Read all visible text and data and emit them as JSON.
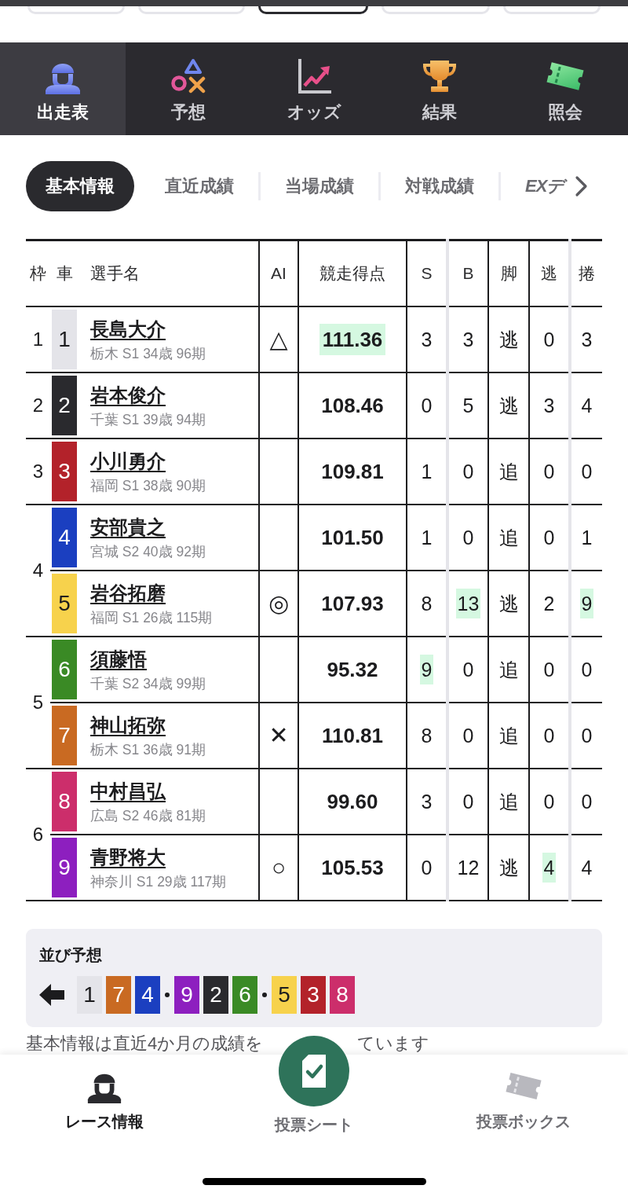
{
  "race_tabs": [
    {
      "selected": false
    },
    {
      "selected": false
    },
    {
      "selected": true
    },
    {
      "selected": false
    },
    {
      "selected": false
    }
  ],
  "main_nav": [
    {
      "label": "出走表",
      "selected": true
    },
    {
      "label": "予想",
      "selected": false
    },
    {
      "label": "オッズ",
      "selected": false
    },
    {
      "label": "結果",
      "selected": false
    },
    {
      "label": "照会",
      "selected": false
    }
  ],
  "sub_tabs": [
    {
      "label": "基本情報",
      "kind": "text",
      "selected": true
    },
    {
      "label": "直近成績",
      "kind": "text",
      "selected": false
    },
    {
      "label": "当場成績",
      "kind": "text",
      "selected": false
    },
    {
      "label": "対戦成績",
      "kind": "text",
      "selected": false
    },
    {
      "label": "EXデ",
      "kind": "logo",
      "selected": false
    }
  ],
  "table": {
    "columns": [
      "枠",
      "車",
      "選手名",
      "AI",
      "競走得点",
      "S",
      "B",
      "脚",
      "逃",
      "捲"
    ],
    "frames": [
      {
        "frame": "1",
        "riders": [
          {
            "car": "1",
            "color": "#e4e4e9",
            "name": "長島大介",
            "profile": "栃木 S1 34歳 96期",
            "ai_mark": "△",
            "score": {
              "value": "111.36",
              "highlighted": true
            },
            "stats": [
              {
                "value": "3",
                "highlighted": false
              },
              {
                "value": "3",
                "highlighted": false
              },
              {
                "value": "逃",
                "highlighted": false
              },
              {
                "value": "0",
                "highlighted": false
              },
              {
                "value": "3",
                "highlighted": false
              }
            ]
          }
        ]
      },
      {
        "frame": "2",
        "riders": [
          {
            "car": "2",
            "color": "#2a2a2e",
            "name": "岩本俊介",
            "profile": "千葉 S1 39歳 94期",
            "score": {
              "value": "108.46",
              "highlighted": false
            },
            "stats": [
              {
                "value": "0",
                "highlighted": false
              },
              {
                "value": "5",
                "highlighted": false
              },
              {
                "value": "逃",
                "highlighted": false
              },
              {
                "value": "3",
                "highlighted": false
              },
              {
                "value": "4",
                "highlighted": false
              }
            ]
          }
        ]
      },
      {
        "frame": "3",
        "riders": [
          {
            "car": "3",
            "color": "#b3222a",
            "name": "小川勇介",
            "profile": "福岡 S1 38歳 90期",
            "score": {
              "value": "109.81",
              "highlighted": false
            },
            "stats": [
              {
                "value": "1",
                "highlighted": false
              },
              {
                "value": "0",
                "highlighted": false
              },
              {
                "value": "追",
                "highlighted": false
              },
              {
                "value": "0",
                "highlighted": false
              },
              {
                "value": "0",
                "highlighted": false
              }
            ]
          }
        ]
      },
      {
        "frame": "4",
        "riders": [
          {
            "car": "4",
            "color": "#1b3fc0",
            "name": "安部貴之",
            "profile": "宮城 S2 40歳 92期",
            "score": {
              "value": "101.50",
              "highlighted": false
            },
            "stats": [
              {
                "value": "1",
                "highlighted": false
              },
              {
                "value": "0",
                "highlighted": false
              },
              {
                "value": "追",
                "highlighted": false
              },
              {
                "value": "0",
                "highlighted": false
              },
              {
                "value": "1",
                "highlighted": false
              }
            ]
          },
          {
            "car": "5",
            "color": "#f7d24c",
            "name": "岩谷拓磨",
            "profile": "福岡 S1 26歳 115期",
            "ai_mark": "◎",
            "score": {
              "value": "107.93",
              "highlighted": false
            },
            "stats": [
              {
                "value": "8",
                "highlighted": false
              },
              {
                "value": "13",
                "highlighted": true
              },
              {
                "value": "逃",
                "highlighted": false
              },
              {
                "value": "2",
                "highlighted": false
              },
              {
                "value": "9",
                "highlighted": true
              }
            ]
          }
        ]
      },
      {
        "frame": "5",
        "riders": [
          {
            "car": "6",
            "color": "#3a8a25",
            "name": "須藤悟",
            "profile": "千葉 S2 34歳 99期",
            "score": {
              "value": "95.32",
              "highlighted": false
            },
            "stats": [
              {
                "value": "9",
                "highlighted": true
              },
              {
                "value": "0",
                "highlighted": false
              },
              {
                "value": "追",
                "highlighted": false
              },
              {
                "value": "0",
                "highlighted": false
              },
              {
                "value": "0",
                "highlighted": false
              }
            ]
          },
          {
            "car": "7",
            "color": "#c96a22",
            "name": "神山拓弥",
            "profile": "栃木 S1 36歳 91期",
            "ai_mark": "✕",
            "score": {
              "value": "110.81",
              "highlighted": false
            },
            "stats": [
              {
                "value": "8",
                "highlighted": false
              },
              {
                "value": "0",
                "highlighted": false
              },
              {
                "value": "追",
                "highlighted": false
              },
              {
                "value": "0",
                "highlighted": false
              },
              {
                "value": "0",
                "highlighted": false
              }
            ]
          }
        ]
      },
      {
        "frame": "6",
        "riders": [
          {
            "car": "8",
            "color": "#cc2e6b",
            "name": "中村昌弘",
            "profile": "広島 S2 46歳 81期",
            "score": {
              "value": "99.60",
              "highlighted": false
            },
            "stats": [
              {
                "value": "3",
                "highlighted": false
              },
              {
                "value": "0",
                "highlighted": false
              },
              {
                "value": "追",
                "highlighted": false
              },
              {
                "value": "0",
                "highlighted": false
              },
              {
                "value": "0",
                "highlighted": false
              }
            ]
          },
          {
            "car": "9",
            "color": "#8d1fbf",
            "name": "青野将大",
            "profile": "神奈川 S1 29歳 117期",
            "ai_mark": "○",
            "score": {
              "value": "105.53",
              "highlighted": false
            },
            "stats": [
              {
                "value": "0",
                "highlighted": false
              },
              {
                "value": "12",
                "highlighted": false
              },
              {
                "value": "逃",
                "highlighted": false
              },
              {
                "value": "4",
                "highlighted": true
              },
              {
                "value": "4",
                "highlighted": false
              }
            ]
          }
        ]
      }
    ]
  },
  "line_prediction": {
    "title": "並び予想",
    "groups": [
      [
        {
          "car": "1",
          "color": "#e4e4e9"
        },
        {
          "car": "7",
          "color": "#c96a22"
        },
        {
          "car": "4",
          "color": "#1b3fc0"
        }
      ],
      [
        {
          "car": "9",
          "color": "#8d1fbf"
        },
        {
          "car": "2",
          "color": "#2a2a2e"
        },
        {
          "car": "6",
          "color": "#3a8a25"
        }
      ],
      [
        {
          "car": "5",
          "color": "#f7d24c"
        },
        {
          "car": "3",
          "color": "#b3222a"
        },
        {
          "car": "8",
          "color": "#cc2e6b"
        }
      ]
    ]
  },
  "footnote": [
    "基本情報は直近4か月の成績を",
    "ています"
  ],
  "bottom_nav": [
    {
      "label": "レース情報",
      "kind": "tab",
      "selected": true
    },
    {
      "label": "投票シート",
      "kind": "action",
      "selected": false
    },
    {
      "label": "投票ボックス",
      "kind": "tab",
      "selected": false
    }
  ]
}
